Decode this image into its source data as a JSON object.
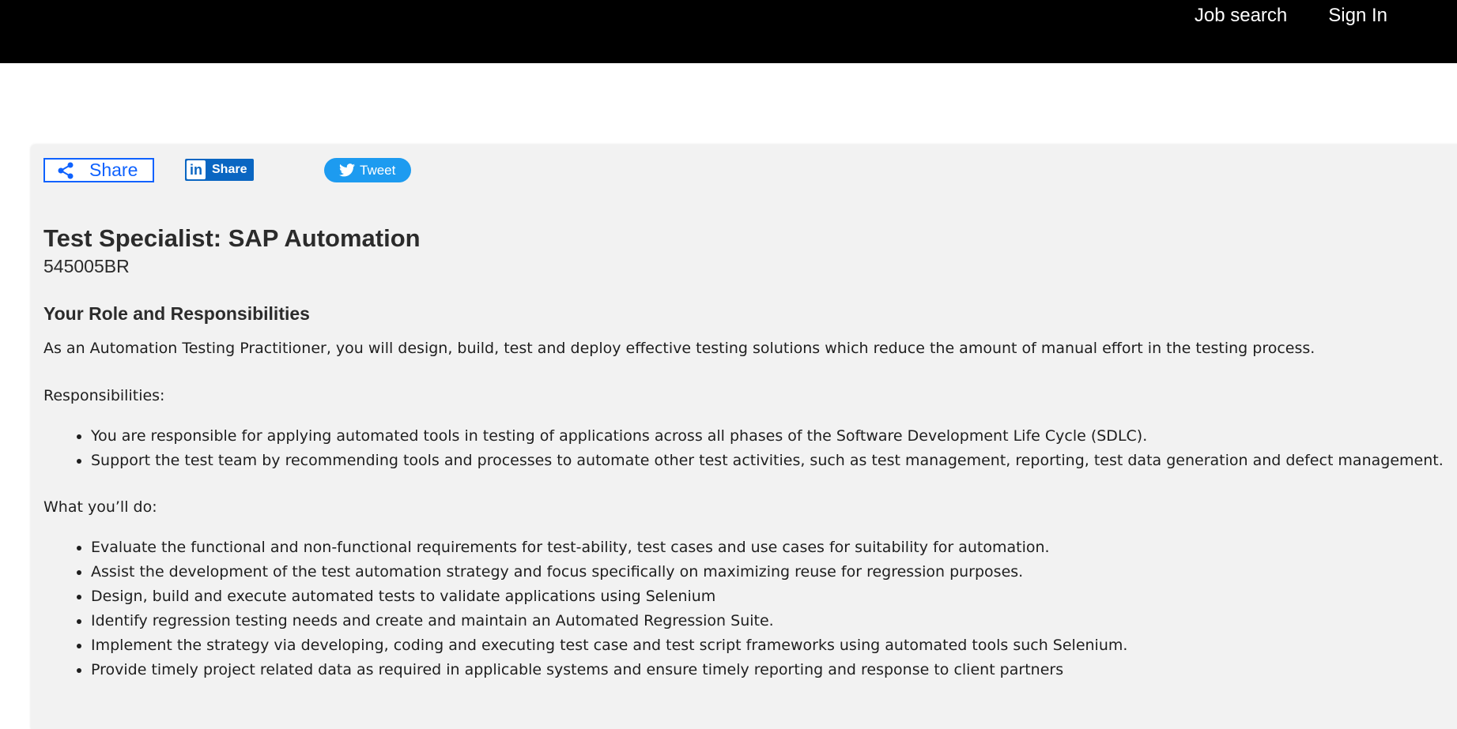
{
  "nav": {
    "job_search": "Job search",
    "sign_in": "Sign In"
  },
  "share": {
    "share_label": "Share",
    "linkedin_label": "Share",
    "linkedin_logo_text": "in",
    "tweet_label": "Tweet"
  },
  "job": {
    "title": "Test Specialist: SAP Automation",
    "id": "545005BR",
    "section_heading": "Your Role and Responsibilities",
    "intro": "As an Automation Testing Practitioner, you will design, build, test and deploy effective testing solutions which reduce the amount of manual effort in the testing process.",
    "responsibilities_label": "Responsibilities:",
    "responsibilities": [
      "You are responsible for applying automated tools in testing of applications across all phases of the Software Development Life Cycle (SDLC).",
      "Support the test team by recommending tools and processes to automate other test activities, such as test management, reporting, test data generation and defect management."
    ],
    "what_label": "What you’ll do:",
    "what_items": [
      "Evaluate the functional and non-functional requirements for test-ability, test cases and use cases for suitability for automation.",
      "Assist the development of the test automation strategy and focus specifically on maximizing reuse for regression purposes.",
      "Design, build and execute automated tests to validate applications using Selenium",
      "Identify regression testing needs and create and maintain an Automated Regression Suite.",
      "Implement the strategy via developing, coding and executing test case and test script frameworks using automated tools such Selenium.",
      "Provide timely project related data as required in applicable systems and ensure timely reporting and response to client partners"
    ]
  },
  "colors": {
    "topbar": "#000000",
    "panel": "#f2f2f2",
    "share_accent": "#0f62fe",
    "linkedin": "#0a66c2",
    "twitter": "#1d9bf0"
  },
  "icons": {
    "share": "share-icon",
    "linkedin": "linkedin-icon",
    "twitter": "twitter-bird-icon"
  }
}
